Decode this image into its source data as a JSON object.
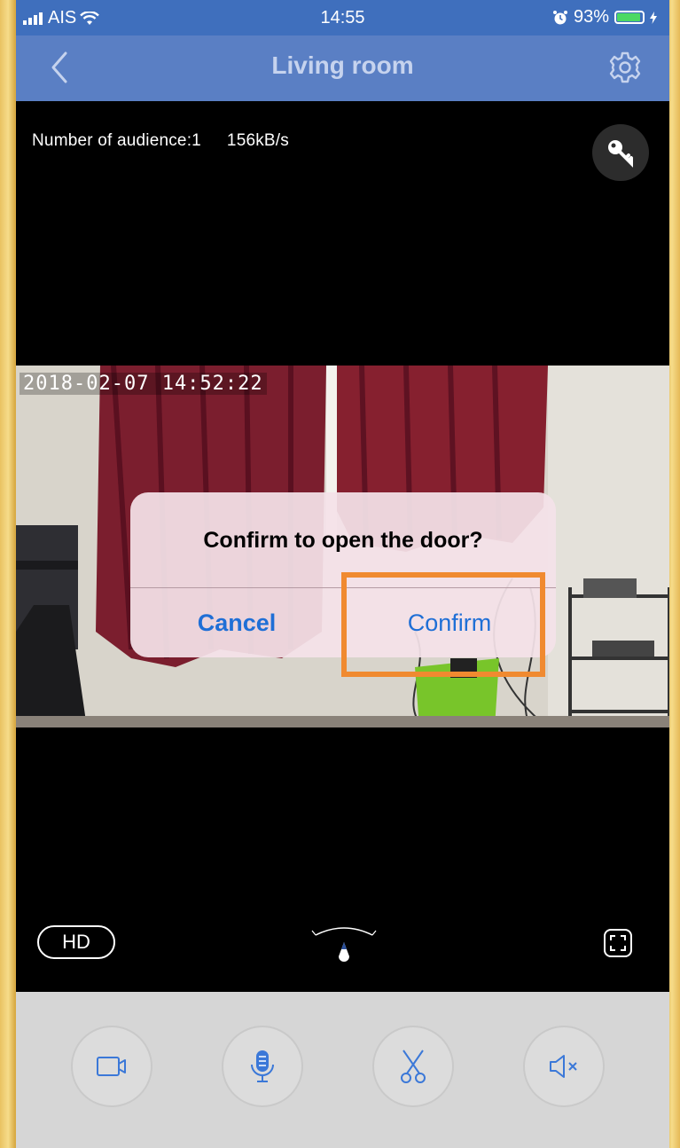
{
  "status_bar": {
    "carrier": "AIS",
    "time": "14:55",
    "battery_percent": "93%",
    "battery_level": 0.93
  },
  "navbar": {
    "title": "Living room"
  },
  "video": {
    "audience_label": "Number of audience:1",
    "bitrate": "156kB/s",
    "timestamp": "2018-02-07   14:52:22"
  },
  "dialog": {
    "title": "Confirm to open the door?",
    "cancel_label": "Cancel",
    "confirm_label": "Confirm"
  },
  "controls": {
    "hd_label": "HD"
  },
  "toolbar": {
    "buttons": [
      "record-video",
      "microphone",
      "screenshot-scissors",
      "mute-speaker"
    ]
  },
  "colors": {
    "nav_blue": "#5a7fc4",
    "accent_blue": "#1f6fd6",
    "highlight_orange": "#f08a30"
  }
}
